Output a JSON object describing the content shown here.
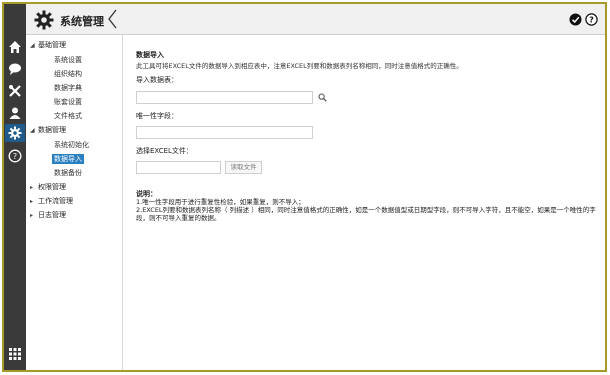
{
  "header": {
    "title": "系统管理",
    "icons": {
      "logo": "gear-icon",
      "collapse": "chevron-left-icon",
      "confirm": "check-circle-icon",
      "help": "help-circle-icon"
    }
  },
  "rail": {
    "icons": [
      "home-icon",
      "chat-icon",
      "tools-icon",
      "user-icon",
      "gear-icon",
      "help-icon",
      "apps-grid-icon"
    ],
    "active": "gear-icon",
    "accent": "#1f5c8b"
  },
  "sidebar": {
    "groups": [
      {
        "label": "基础管理",
        "expanded": true,
        "items": [
          "系统设置",
          "组织结构",
          "数据字典",
          "账套设置",
          "文件格式"
        ]
      },
      {
        "label": "数据管理",
        "expanded": true,
        "items": [
          "系统初始化",
          "数据导入",
          "数据备份"
        ]
      },
      {
        "label": "权限管理",
        "expanded": false
      },
      {
        "label": "工作流管理",
        "expanded": false
      },
      {
        "label": "日志管理",
        "expanded": false
      }
    ],
    "selected": "数据导入",
    "selected_color": "#2a7fc1"
  },
  "main": {
    "section_title": "数据导入",
    "description": "此工具可将EXCEL文件的数据导入到相应表中，注意EXCEL列要和数据表列名称相同，同时注意值格式的正确性。",
    "import_table_label": "导入数据表：",
    "import_table_value": "",
    "unique_field_label": "唯一性字段：",
    "unique_field_value": "",
    "excel_file_label": "选择EXCEL文件：",
    "excel_file_value": "",
    "read_file_button": "读取文件",
    "notes_title": "说明：",
    "note1": "1.唯一性字段用于进行重复性检验，如果重复，则不导入；",
    "note2": "2.EXCEL列要和数据表列名称（ 列描述 ）相同，同时注意值格式的正确性，如是一个数据值型或日期型字段，则不可导入字符，且不能空，如果是一个唯性的字段，则不可导入重复的数据。"
  },
  "colors": {
    "frame_border": "#a89a2a",
    "rail_bg": "#3a3a3a"
  }
}
